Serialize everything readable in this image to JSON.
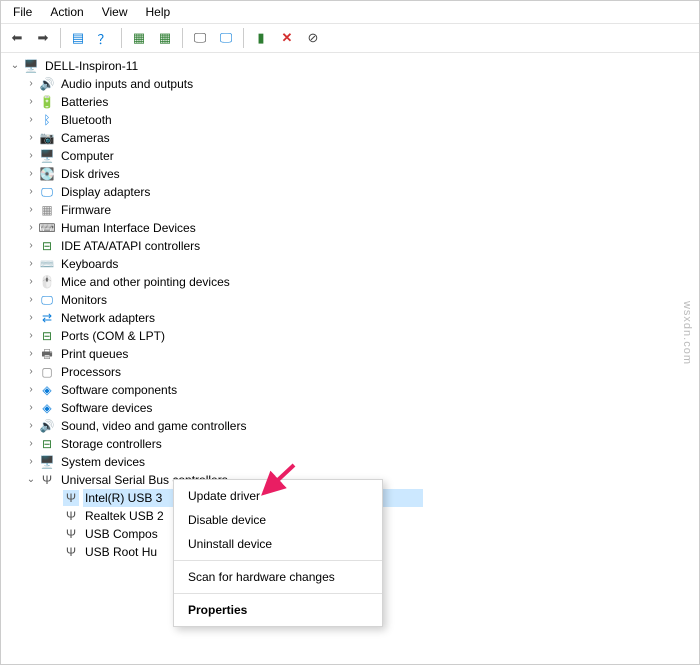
{
  "menu": {
    "file": "File",
    "action": "Action",
    "view": "View",
    "help": "Help"
  },
  "toolbar_icons": [
    "back",
    "forward",
    "sep",
    "list",
    "sep",
    "help",
    "sep",
    "scan",
    "enable",
    "sep",
    "monitor1",
    "monitor2",
    "sep",
    "update",
    "remove",
    "stop"
  ],
  "tree": {
    "root": {
      "label": "DELL-Inspiron-11",
      "expander": "⌄",
      "icon": "🖥️"
    },
    "categories": [
      {
        "icon": "🔊",
        "label": "Audio inputs and outputs"
      },
      {
        "icon": "🔋",
        "label": "Batteries"
      },
      {
        "icon": "ᛒ",
        "label": "Bluetooth",
        "iconColor": "#1e88e5"
      },
      {
        "icon": "📷",
        "label": "Cameras"
      },
      {
        "icon": "🖥️",
        "label": "Computer"
      },
      {
        "icon": "💽",
        "label": "Disk drives"
      },
      {
        "icon": "🖵",
        "label": "Display adapters",
        "iconColor": "#0b7dda"
      },
      {
        "icon": "▦",
        "label": "Firmware",
        "iconColor": "#888"
      },
      {
        "icon": "⌨",
        "label": "Human Interface Devices",
        "iconColor": "#666"
      },
      {
        "icon": "⊟",
        "label": "IDE ATA/ATAPI controllers",
        "iconColor": "#2e7d32"
      },
      {
        "icon": "⌨️",
        "label": "Keyboards"
      },
      {
        "icon": "🖱️",
        "label": "Mice and other pointing devices"
      },
      {
        "icon": "🖵",
        "label": "Monitors",
        "iconColor": "#0b7dda"
      },
      {
        "icon": "⇄",
        "label": "Network adapters",
        "iconColor": "#0b7dda"
      },
      {
        "icon": "⊟",
        "label": "Ports (COM & LPT)",
        "iconColor": "#2e7d32"
      },
      {
        "icon": "🖶",
        "label": "Print queues",
        "iconColor": "#666"
      },
      {
        "icon": "▢",
        "label": "Processors",
        "iconColor": "#888"
      },
      {
        "icon": "◈",
        "label": "Software components",
        "iconColor": "#0b7dda"
      },
      {
        "icon": "◈",
        "label": "Software devices",
        "iconColor": "#0b7dda"
      },
      {
        "icon": "🔊",
        "label": "Sound, video and game controllers"
      },
      {
        "icon": "⊟",
        "label": "Storage controllers",
        "iconColor": "#2e7d32"
      },
      {
        "icon": "🖥️",
        "label": "System devices"
      }
    ],
    "usb": {
      "label": "Universal Serial Bus controllers",
      "icon": "Ψ",
      "expander": "⌄",
      "children": [
        {
          "icon": "Ψ",
          "label": "Intel(R) USB 3",
          "selected": true
        },
        {
          "icon": "Ψ",
          "label": "Realtek USB 2"
        },
        {
          "icon": "Ψ",
          "label": "USB Compos"
        },
        {
          "icon": "Ψ",
          "label": "USB Root Hu"
        }
      ]
    }
  },
  "context_menu": {
    "update": "Update driver",
    "disable": "Disable device",
    "uninstall": "Uninstall device",
    "scan": "Scan for hardware changes",
    "properties": "Properties"
  },
  "watermark": "wsxdn.com"
}
